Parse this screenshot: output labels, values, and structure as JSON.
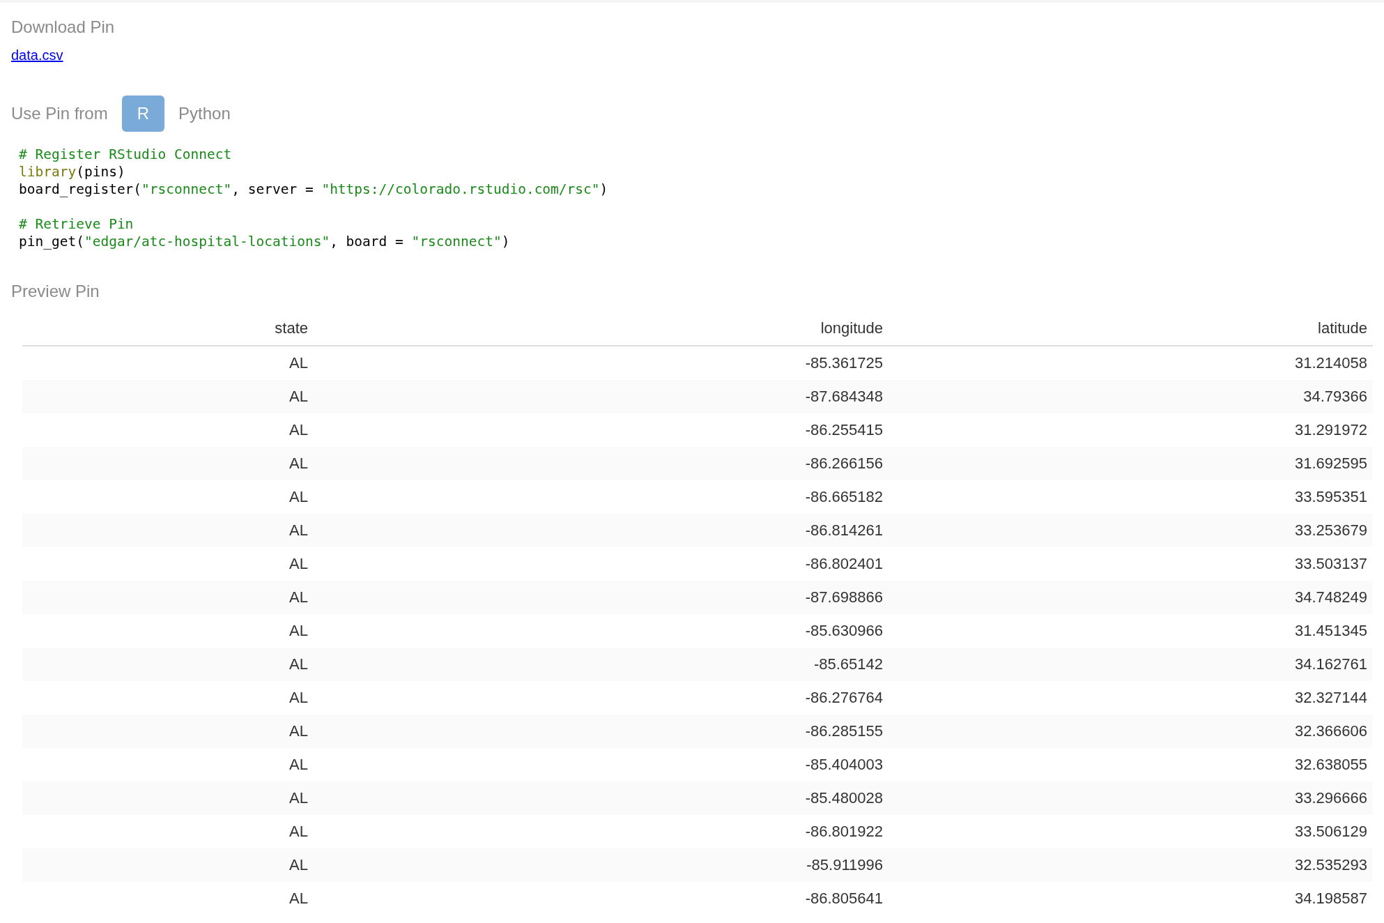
{
  "download": {
    "title": "Download Pin",
    "link": "data.csv"
  },
  "use_pin": {
    "label": "Use Pin from",
    "tabs": [
      {
        "label": "R",
        "selected": true
      },
      {
        "label": "Python",
        "selected": false
      }
    ],
    "code_blocks": [
      [
        [
          {
            "kind": "comment",
            "text": "# Register RStudio Connect"
          }
        ],
        [
          {
            "kind": "function",
            "text": "library"
          },
          {
            "kind": "plain",
            "text": "(pins)"
          }
        ],
        [
          {
            "kind": "plain",
            "text": "board_register("
          },
          {
            "kind": "string",
            "text": "\"rsconnect\""
          },
          {
            "kind": "plain",
            "text": ", server = "
          },
          {
            "kind": "string",
            "text": "\"https://colorado.rstudio.com/rsc\""
          },
          {
            "kind": "plain",
            "text": ")"
          }
        ]
      ],
      [
        [
          {
            "kind": "comment",
            "text": "# Retrieve Pin"
          }
        ],
        [
          {
            "kind": "plain",
            "text": "pin_get("
          },
          {
            "kind": "string",
            "text": "\"edgar/atc-hospital-locations\""
          },
          {
            "kind": "plain",
            "text": ", board = "
          },
          {
            "kind": "string",
            "text": "\"rsconnect\""
          },
          {
            "kind": "plain",
            "text": ")"
          }
        ]
      ]
    ]
  },
  "preview": {
    "title": "Preview Pin",
    "table": {
      "columns": [
        "state",
        "longitude",
        "latitude"
      ],
      "rows": [
        [
          "AL",
          "-85.361725",
          "31.214058"
        ],
        [
          "AL",
          "-87.684348",
          "34.79366"
        ],
        [
          "AL",
          "-86.255415",
          "31.291972"
        ],
        [
          "AL",
          "-86.266156",
          "31.692595"
        ],
        [
          "AL",
          "-86.665182",
          "33.595351"
        ],
        [
          "AL",
          "-86.814261",
          "33.253679"
        ],
        [
          "AL",
          "-86.802401",
          "33.503137"
        ],
        [
          "AL",
          "-87.698866",
          "34.748249"
        ],
        [
          "AL",
          "-85.630966",
          "31.451345"
        ],
        [
          "AL",
          "-85.65142",
          "34.162761"
        ],
        [
          "AL",
          "-86.276764",
          "32.327144"
        ],
        [
          "AL",
          "-86.285155",
          "32.366606"
        ],
        [
          "AL",
          "-85.404003",
          "32.638055"
        ],
        [
          "AL",
          "-85.480028",
          "33.296666"
        ],
        [
          "AL",
          "-86.801922",
          "33.506129"
        ],
        [
          "AL",
          "-85.911996",
          "32.535293"
        ],
        [
          "AL",
          "-86.805641",
          "34.198587"
        ]
      ]
    }
  }
}
